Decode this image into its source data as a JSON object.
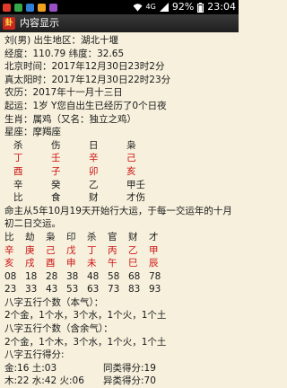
{
  "status_bar": {
    "signal_label": "4G",
    "battery": "92%",
    "time": "23:04",
    "icon_colors": [
      "#e03b2a",
      "#2f7fd6",
      "#37a84a",
      "#f0a21f",
      "#9a4fc9"
    ]
  },
  "app_bar": {
    "logo": "卦",
    "title": "内容显示"
  },
  "info": {
    "line1": "刘(男) 出生地区：湖北十堰",
    "line2": "经度：110.79 纬度：32.65",
    "line3": "北京时间：2017年12月30日23时2分",
    "line4": "真太阳时：2017年12月30日22时23分",
    "line5": "农历：2017年十一月十三日",
    "line6": "起运：1岁 Y您自出生已经历了0个日夜",
    "line7": "生肖：属鸡（又名：独立之鸡）",
    "line8": "星座：摩羯座"
  },
  "pillars": {
    "gods_top": [
      "杀",
      "伤",
      "日",
      "枭"
    ],
    "stems": [
      "丁",
      "壬",
      "辛",
      "己"
    ],
    "branches": [
      "酉",
      "子",
      "卯",
      "亥"
    ],
    "hidden": [
      "辛",
      "癸",
      "乙",
      "甲壬"
    ],
    "gods_bottom": [
      "比",
      "食",
      "财",
      "才伤"
    ]
  },
  "luck_intro": "命主从5年10月19天开始行大运，于每一交运年的十月初二日交运。",
  "luck": {
    "gods": [
      "比",
      "劫",
      "枭",
      "印",
      "杀",
      "官",
      "财",
      "才"
    ],
    "stems": [
      "辛",
      "庚",
      "己",
      "戊",
      "丁",
      "丙",
      "乙",
      "甲"
    ],
    "branches": [
      "亥",
      "戌",
      "酉",
      "申",
      "未",
      "午",
      "巳",
      "辰"
    ],
    "start_ages": [
      "08",
      "18",
      "28",
      "38",
      "48",
      "58",
      "68",
      "78"
    ],
    "start_years": [
      "23",
      "33",
      "43",
      "53",
      "63",
      "73",
      "83",
      "93"
    ]
  },
  "five_elements": {
    "benqi_title": "八字五行个数（本气）：",
    "benqi": "2个金，1个水，3个水，1个火，1个土",
    "hanyuqi_title": "八字五行个数（含余气）：",
    "hanyuqi": "2个金，1个木，3个水，1个火，1个土",
    "score_title": "八字五行得分:",
    "score1_left": "金:16 土:03",
    "score1_right": "同类得分:19",
    "score2_left": "木:22 水:42 火:06",
    "score2_right": "异类得分:70"
  }
}
